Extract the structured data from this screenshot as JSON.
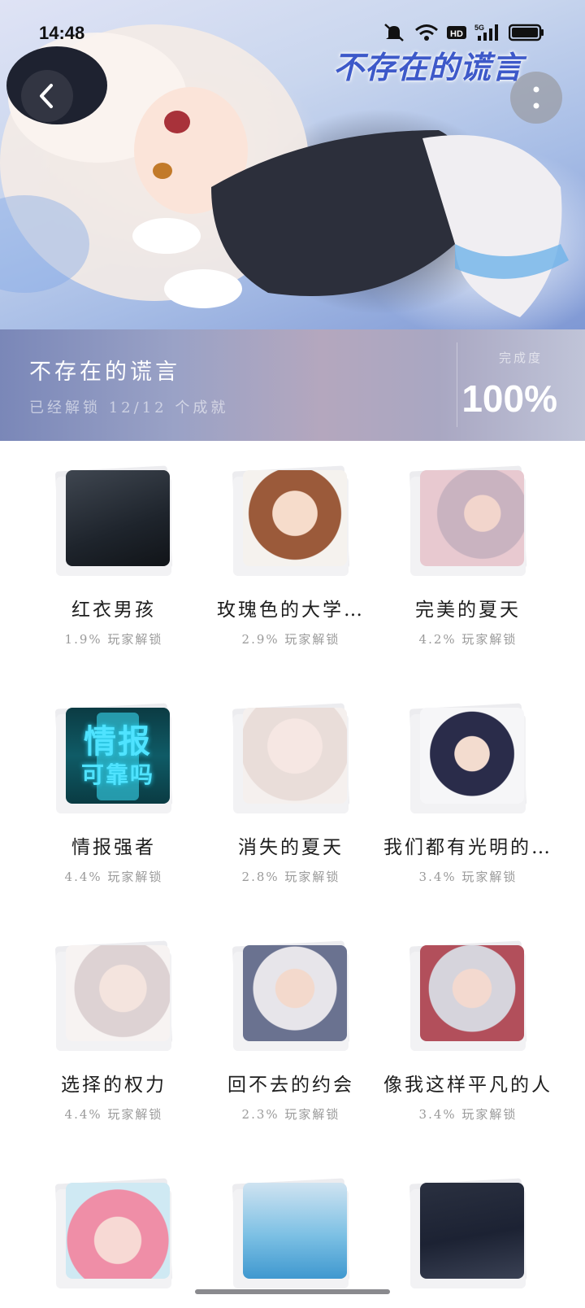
{
  "status_bar": {
    "time": "14:48"
  },
  "hero": {
    "logo_text": "不存在的谎言",
    "back_icon": "chevron-left-icon",
    "more_icon": "more-vertical-icon"
  },
  "info": {
    "title": "不存在的谎言",
    "subtitle": "已经解锁 12/12 个成就",
    "progress_label": "完成度",
    "progress_value": "100%"
  },
  "achievements": [
    {
      "title": "红衣男孩",
      "unlock": "1.9% 玩家解锁",
      "palette": "t-dark"
    },
    {
      "title": "玫瑰色的大学…",
      "unlock": "2.9% 玩家解锁",
      "palette": "t-brown"
    },
    {
      "title": "完美的夏天",
      "unlock": "4.2% 玩家解锁",
      "palette": "t-silver"
    },
    {
      "title": "情报强者",
      "unlock": "4.4% 玩家解锁",
      "palette": "t-cyan",
      "thumb_text_1": "情报",
      "thumb_text_2": "可靠吗"
    },
    {
      "title": "消失的夏天",
      "unlock": "2.8% 玩家解锁",
      "palette": "t-sketch"
    },
    {
      "title": "我们都有光明的…",
      "unlock": "3.4% 玩家解锁",
      "palette": "t-glasses"
    },
    {
      "title": "选择的权力",
      "unlock": "4.4% 玩家解锁",
      "palette": "t-pale"
    },
    {
      "title": "回不去的约会",
      "unlock": "2.3% 玩家解锁",
      "palette": "t-white"
    },
    {
      "title": "像我这样平凡的人",
      "unlock": "3.4% 玩家解锁",
      "palette": "t-silver2"
    },
    {
      "title": "",
      "unlock": "",
      "palette": "t-pink"
    },
    {
      "title": "",
      "unlock": "",
      "palette": "t-pool"
    },
    {
      "title": "",
      "unlock": "",
      "palette": "t-night"
    }
  ]
}
